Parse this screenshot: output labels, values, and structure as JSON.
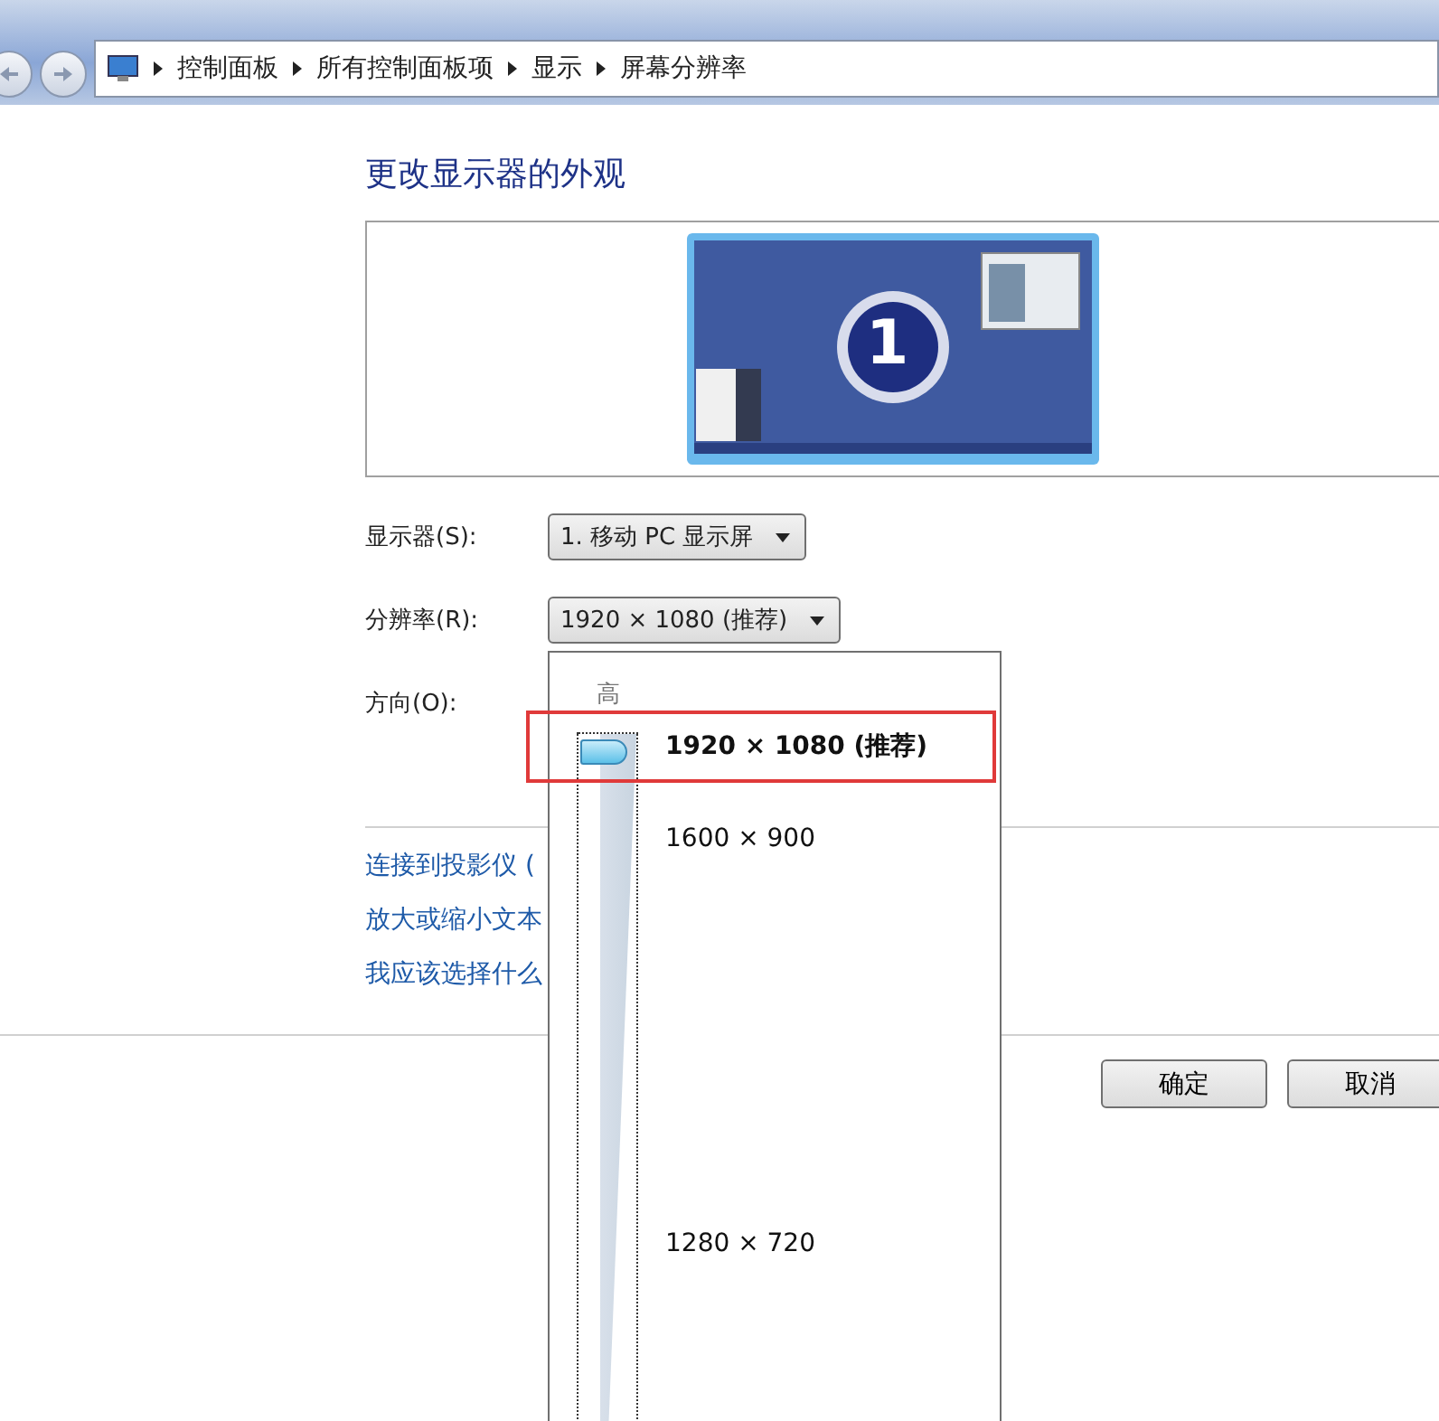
{
  "breadcrumb": [
    "控制面板",
    "所有控制面板项",
    "显示",
    "屏幕分辨率"
  ],
  "title": "更改显示器的外观",
  "monitor": {
    "number": "1"
  },
  "fields": [
    {
      "label": "显示器(S):",
      "value": "1. 移动 PC 显示屏",
      "kind": "dropdown"
    },
    {
      "label": "分辨率(R):",
      "value": "1920 × 1080 (推荐)",
      "kind": "dropdown"
    },
    {
      "label": "方向(O):",
      "kind": "label"
    }
  ],
  "links": [
    "连接到投影仪 (",
    "放大或缩小文本",
    "我应该选择什么"
  ],
  "resolution_popup": {
    "top_label": "高",
    "level": 1,
    "options": [
      {
        "label": "1920 × 1080 (推荐)",
        "selected": true
      },
      {
        "label": "1600 × 900",
        "selected": false
      },
      {
        "label": "1280 × 720",
        "selected": false
      }
    ]
  },
  "buttons": [
    "确定",
    "取消"
  ]
}
